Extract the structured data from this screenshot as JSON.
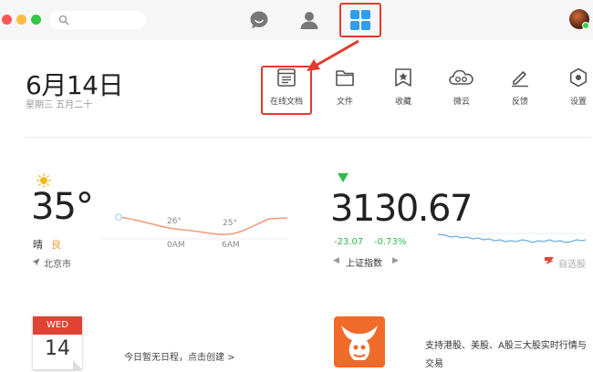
{
  "search": {
    "placeholder": ""
  },
  "date": {
    "big": "6月14日",
    "sub": "星期三  五月二十"
  },
  "toolbar": {
    "items": [
      {
        "label": "在线文档",
        "icon": "doc-icon"
      },
      {
        "label": "文件",
        "icon": "folder-icon"
      },
      {
        "label": "收藏",
        "icon": "bookmark-star-icon"
      },
      {
        "label": "微云",
        "icon": "cloud-icon"
      },
      {
        "label": "反馈",
        "icon": "pencil-icon"
      },
      {
        "label": "设置",
        "icon": "hexagon-gear-icon"
      }
    ]
  },
  "weather": {
    "temp": "35°",
    "condition": "晴",
    "aqi": "良",
    "city": "北京市",
    "forecast": [
      {
        "temp": "26°",
        "time": "0AM"
      },
      {
        "temp": "25°",
        "time": "6AM"
      }
    ]
  },
  "stock": {
    "value": "3130.67",
    "change": "-23.07",
    "percent": "-0.73%",
    "name": "上证指数",
    "watchlist": "自选股"
  },
  "calendar": {
    "weekday": "WED",
    "day": "14",
    "message": "今日暂无日程，点击创建 >"
  },
  "promo": {
    "text": "支持港股、美股、A股三大股实时行情与交易"
  },
  "colors": {
    "highlight": "#e33b2d",
    "stock_down": "#2dbd4e",
    "aqi": "#e6a23c"
  }
}
